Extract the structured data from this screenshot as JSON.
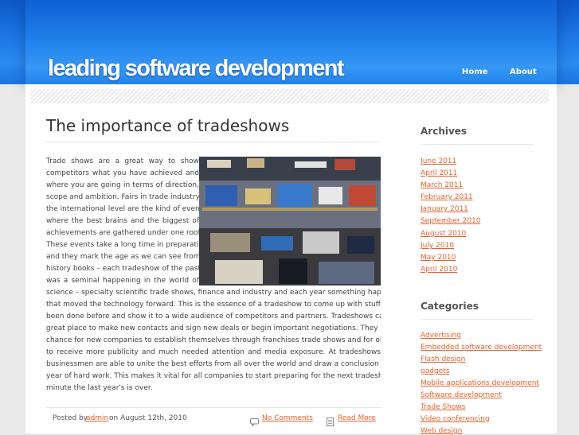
{
  "header": {
    "site_title": "leading software development",
    "nav": [
      "Home",
      "About"
    ]
  },
  "post": {
    "title": "The importance of tradeshows",
    "lines": [
      "Trade shows are a great way to show",
      "competitors what you have achieved and",
      "where you are going in terms of direction,",
      "scope and ambition. Fairs in trade industry on",
      "the international level are the kind of events",
      "where the best brains and the biggest of",
      "achievements are gathered under one roof.",
      "These events take a long time in preparation",
      "and they mark the age as we can see from",
      "history books – each tradeshow of the past",
      "was a seminal happening in the world of",
      "science – specialty scientific trade shows, finance and industry and each year something happened",
      "that moved the technology forward. This is the essence of a tradeshow to come up with stuff that hasn't",
      "been done before and show it to a wide audience of competitors and partners. Tradeshows can be a",
      "great place to make new contacts and sign new deals or begin important negotiations. They are a",
      "chance for new companies to establish themselves through franchises trade shows and for older ones",
      "to receive more publicity and much needed attention and media exposure. At tradeshows",
      "businessmen are able to unite the best efforts from all over the world and draw a conclusion to a fruitful",
      "year of hard work. This makes it vital for all companies to start preparing for the next tradeshow the",
      "minute the last year's is over."
    ],
    "meta": {
      "posted_by": "Posted by",
      "author": "admin",
      "date": "on August 12th, 2010",
      "comments": "No Comments",
      "read_more": "Read More"
    }
  },
  "sidebar": {
    "archives_title": "Archives",
    "archives": [
      "June 2011",
      "April 2011",
      "March 2011",
      "February 2011",
      "January 2011",
      "September 2010",
      "August 2010",
      "July 2010",
      "May 2010",
      "April 2010"
    ],
    "categories_title": "Categories",
    "categories": [
      "Advertising",
      "Embedded software development",
      "Flash design",
      "gadgets",
      "Mobile applications development",
      "Software development",
      "Trade Shows",
      "Video conferencing",
      "Web design"
    ]
  },
  "colors": {
    "header_blue": "#1d78e6",
    "link_orange": "#e8602c",
    "text_gray": "#444444"
  }
}
